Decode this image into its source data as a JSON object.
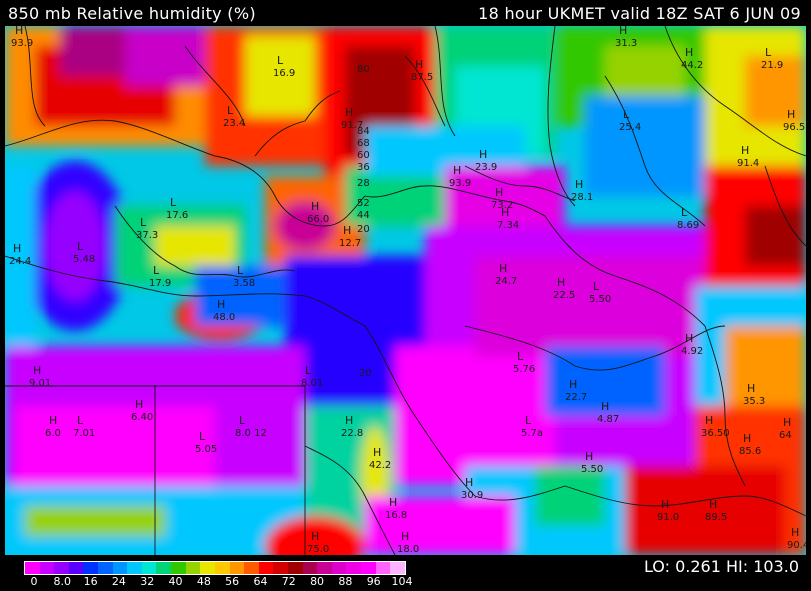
{
  "header": {
    "left_title": "850 mb Relative humidity (%)",
    "right_title": "18 hour UKMET valid 18Z SAT  6 JUN 09"
  },
  "footer": {
    "lo_hi": "LO: 0.261  HI: 103.0",
    "colorbar_labels": [
      "0",
      "8.0",
      "16",
      "24",
      "32",
      "40",
      "48",
      "56",
      "64",
      "72",
      "80",
      "88",
      "96",
      "104"
    ],
    "colorbar_colors": [
      "#ff00ff",
      "#c800ff",
      "#9600ff",
      "#5a00ff",
      "#0032ff",
      "#0064ff",
      "#0096ff",
      "#00c8ff",
      "#00e6d2",
      "#00d278",
      "#32c800",
      "#96d200",
      "#e6e600",
      "#ffc800",
      "#ff9600",
      "#ff5a00",
      "#ff0000",
      "#d20000",
      "#a00000",
      "#aa0050",
      "#c80096",
      "#dc00c8",
      "#f000e6",
      "#ff00ff",
      "#ff64ff",
      "#ffb4ff"
    ]
  },
  "markers": [
    {
      "sym": "H",
      "val": "93.9"
    },
    {
      "sym": "L",
      "val": "16.9"
    },
    {
      "sym": "H",
      "val": "87.5"
    },
    {
      "sym": "H",
      "val": "31.3"
    },
    {
      "sym": "H",
      "val": "44.2"
    },
    {
      "sym": "L",
      "val": "21.9"
    },
    {
      "sym": "L",
      "val": "23.4"
    },
    {
      "sym": "H",
      "val": "91.7"
    },
    {
      "sym": "L",
      "val": "25.4"
    },
    {
      "sym": "H",
      "val": "96.5"
    },
    {
      "sym": "H",
      "val": "91.4"
    },
    {
      "sym": "H",
      "val": "23.9"
    },
    {
      "sym": "H",
      "val": "93.9"
    },
    {
      "sym": "H",
      "val": "73.2"
    },
    {
      "sym": "H",
      "val": "28.1"
    },
    {
      "sym": "L",
      "val": "17.6"
    },
    {
      "sym": "L",
      "val": "37.3"
    },
    {
      "sym": "H",
      "val": "66.0"
    },
    {
      "sym": "H",
      "val": "12.7"
    },
    {
      "sym": "H",
      "val": "7.34"
    },
    {
      "sym": "L",
      "val": "8.69"
    },
    {
      "sym": "H",
      "val": "24.4"
    },
    {
      "sym": "L",
      "val": "5.48"
    },
    {
      "sym": "L",
      "val": "17.9"
    },
    {
      "sym": "L",
      "val": "3.58"
    },
    {
      "sym": "H",
      "val": "24.7"
    },
    {
      "sym": "H",
      "val": "22.5"
    },
    {
      "sym": "L",
      "val": "5.50"
    },
    {
      "sym": "H",
      "val": "48.0"
    },
    {
      "sym": "H",
      "val": "4.92"
    },
    {
      "sym": "L",
      "val": "5.76"
    },
    {
      "sym": "L",
      "val": "8.01"
    },
    {
      "sym": "H",
      "val": "9.01"
    },
    {
      "sym": "H",
      "val": "22.7"
    },
    {
      "sym": "H",
      "val": "6.40"
    },
    {
      "sym": "H",
      "val": "4.87"
    },
    {
      "sym": "H",
      "val": "6.0"
    },
    {
      "sym": "L",
      "val": "7.01"
    },
    {
      "sym": "L",
      "val": "8.0 12"
    },
    {
      "sym": "H",
      "val": "22.8"
    },
    {
      "sym": "L",
      "val": "5.7a"
    },
    {
      "sym": "H",
      "val": "36.50"
    },
    {
      "sym": "H",
      "val": "64"
    },
    {
      "sym": "L",
      "val": "5.05"
    },
    {
      "sym": "H",
      "val": "42.2"
    },
    {
      "sym": "H",
      "val": "5.50"
    },
    {
      "sym": "H",
      "val": "85.6"
    },
    {
      "sym": "H",
      "val": "30.9"
    },
    {
      "sym": "H",
      "val": "16.8"
    },
    {
      "sym": "H",
      "val": "91.0"
    },
    {
      "sym": "H",
      "val": "89.5"
    },
    {
      "sym": "H",
      "val": "75.0"
    },
    {
      "sym": "H",
      "val": "18.0"
    },
    {
      "sym": "H",
      "val": "90.4"
    },
    {
      "sym": "H",
      "val": "35.3"
    }
  ],
  "contour_labels": [
    "80",
    "84",
    "68",
    "60",
    "52",
    "44",
    "36",
    "28",
    "20",
    "20"
  ]
}
